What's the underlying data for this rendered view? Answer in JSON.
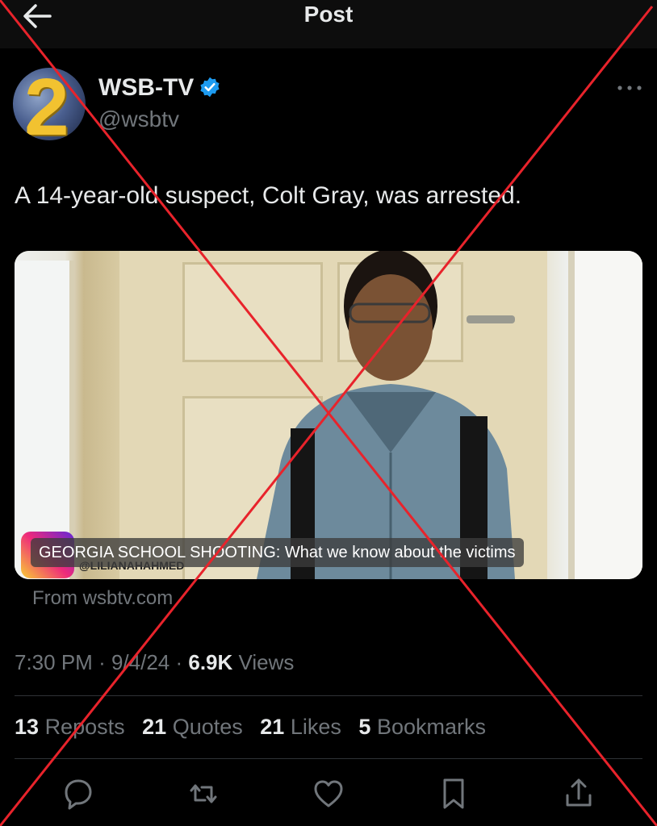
{
  "header": {
    "title": "Post",
    "back_icon": "arrow-left-icon"
  },
  "author": {
    "avatar_text": "2",
    "name": "WSB-TV",
    "verified": true,
    "handle": "@wsbtv"
  },
  "tweet": {
    "text": "A 14-year-old suspect, Colt Gray, was arrested.",
    "media": {
      "caption": "GEORGIA SCHOOL SHOOTING: What we know about the victims",
      "watermark": "@LILIANAHAHMED"
    },
    "source": "From wsbtv.com",
    "time": "7:30 PM",
    "date": "9/4/24",
    "views_count": "6.9K",
    "views_label": "Views"
  },
  "stats": {
    "reposts_count": "13",
    "reposts_label": "Reposts",
    "quotes_count": "21",
    "quotes_label": "Quotes",
    "likes_count": "21",
    "likes_label": "Likes",
    "bookmarks_count": "5",
    "bookmarks_label": "Bookmarks"
  },
  "actions": [
    "reply-icon",
    "repost-icon",
    "like-icon",
    "bookmark-icon",
    "share-icon"
  ],
  "colors": {
    "overlay_cross": "#e8232b",
    "verified_badge": "#1d9bf0",
    "muted_text": "#71767b"
  }
}
